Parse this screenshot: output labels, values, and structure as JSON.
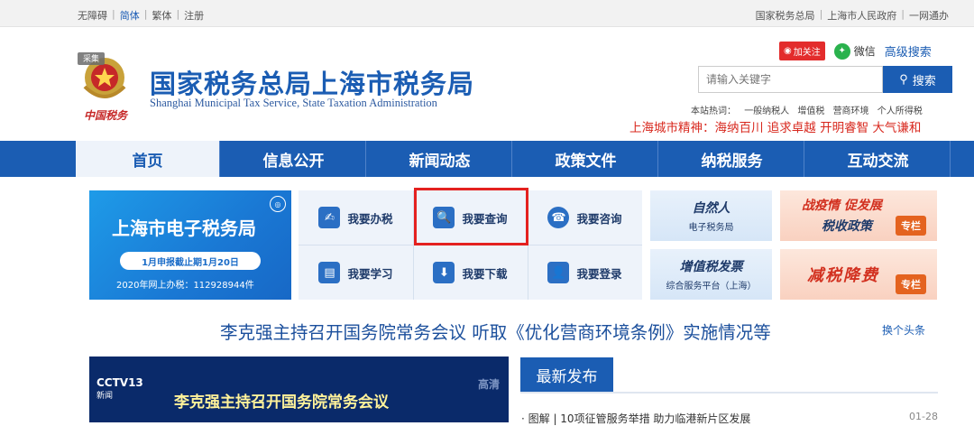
{
  "topbar": {
    "left": [
      "无障碍",
      "简体",
      "繁体",
      "注册"
    ],
    "right": [
      "国家税务总局",
      "上海市人民政府",
      "一网通办"
    ]
  },
  "header": {
    "title_cn": "国家税务总局上海市税务局",
    "title_en": "Shanghai Municipal Tax Service, State Taxation Administration",
    "emblem_text": "中国税务",
    "emblem_tag": "采集",
    "weibo_label": "加关注",
    "weixin_label": "微信",
    "advanced_search": "高级搜索",
    "search_placeholder": "请输入关键字",
    "search_button": "搜索",
    "hot_words_label": "本站热词：",
    "hot_words": [
      "一般纳税人",
      "增值税",
      "营商环境",
      "个人所得税"
    ],
    "city_spirit": "上海城市精神：海纳百川 追求卓越 开明睿智 大气谦和"
  },
  "nav": [
    "首页",
    "信息公开",
    "新闻动态",
    "政策文件",
    "纳税服务",
    "互动交流"
  ],
  "etax": {
    "title": "上海市电子税务局",
    "pill": "1月申报截止期1月20日",
    "count": "2020年网上办税：112928944件"
  },
  "services": [
    {
      "label": "我要办税",
      "icon": "✍"
    },
    {
      "label": "我要查询",
      "icon": "🔍"
    },
    {
      "label": "我要咨询",
      "icon": "☎"
    },
    {
      "label": "我要学习",
      "icon": "▤"
    },
    {
      "label": "我要下载",
      "icon": "⬇"
    },
    {
      "label": "我要登录",
      "icon": "👤"
    }
  ],
  "side_cards": {
    "natural": {
      "big": "自然人",
      "small": "电子税务局"
    },
    "vat": {
      "big": "增值税发票",
      "small": "综合服务平台（上海）"
    },
    "promo1": {
      "line1": "战疫情 促发展",
      "line2": "税收政策",
      "tag": "专栏"
    },
    "promo2": {
      "line1": "减税降费",
      "tag": "专栏"
    }
  },
  "headline": "李克强主持召开国务院常务会议 听取《优化营商环境条例》实施情况等",
  "change_headline": "换个头条",
  "video": {
    "channel": "CCTV13",
    "sub": "新闻",
    "hd": "高清",
    "caption": "李克强主持召开国务院常务会议"
  },
  "latest": {
    "tab": "最新发布",
    "items": [
      {
        "title": "· 图解 | 10项征管服务举措 助力临港新片区发展",
        "date": "01-28"
      }
    ]
  },
  "colors": {
    "brand": "#1b5db3",
    "highlight": "#e4211f",
    "spirit": "#d8281e"
  }
}
